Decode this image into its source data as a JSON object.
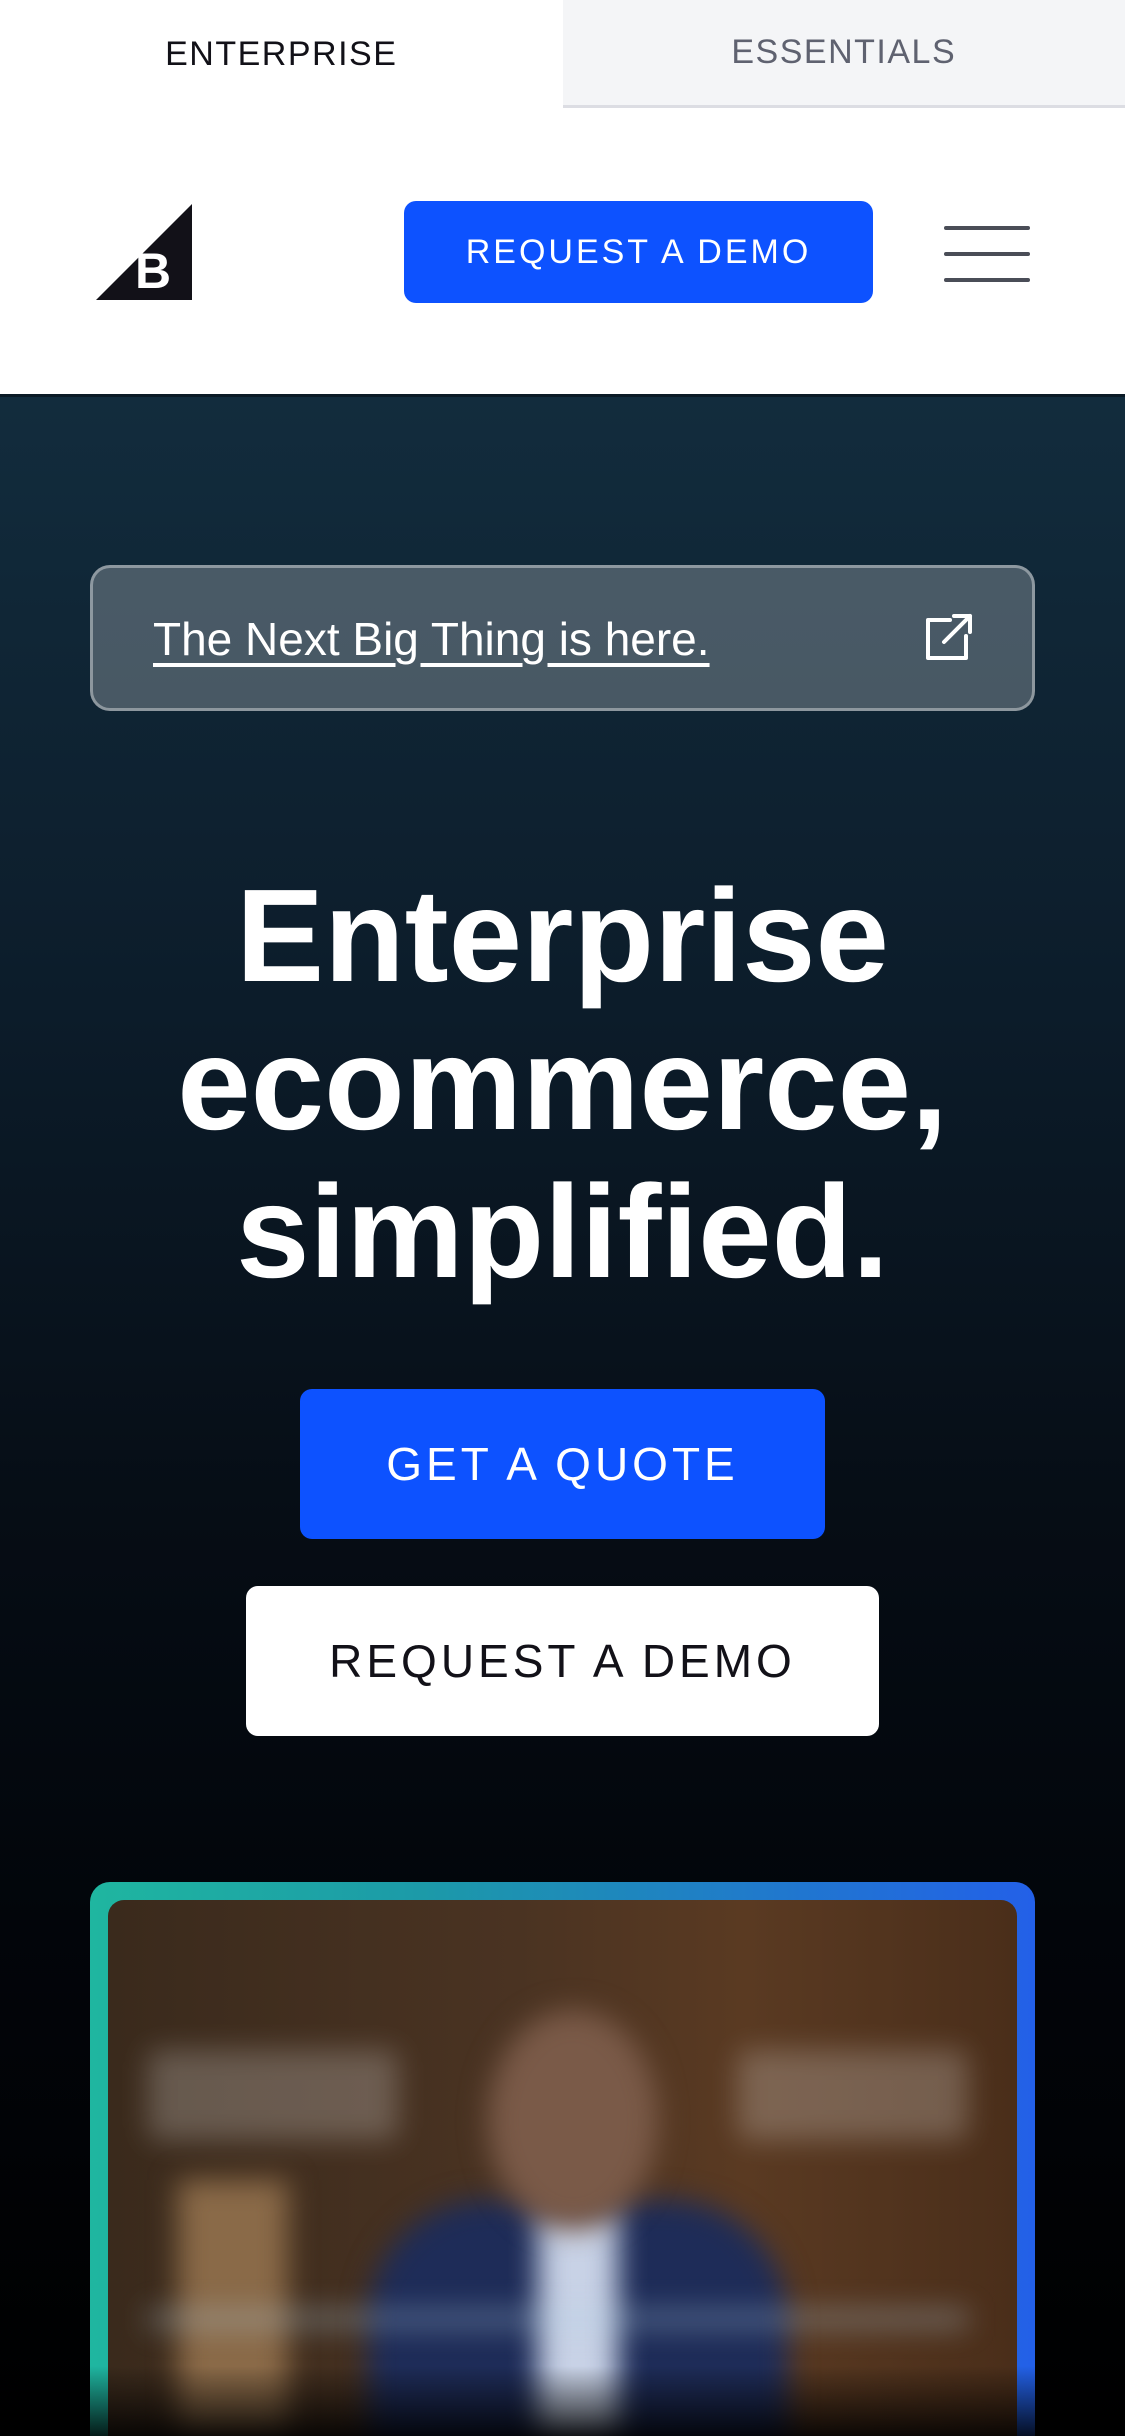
{
  "tabs": [
    {
      "label": "ENTERPRISE",
      "active": true
    },
    {
      "label": "ESSENTIALS",
      "active": false
    }
  ],
  "header": {
    "logo_icon": "bigcommerce-logo-icon",
    "cta_label": "REQUEST A DEMO",
    "menu_icon": "hamburger-menu-icon"
  },
  "hero": {
    "announcement": {
      "link_text": "The Next Big Thing is here.",
      "icon": "external-link-icon"
    },
    "headline_lines": [
      "Enterprise",
      "ecommerce,",
      "simplified."
    ],
    "primary_cta": "GET A QUOTE",
    "secondary_cta": "REQUEST A DEMO"
  },
  "video": {
    "thumbnail": "blurred-video-thumbnail"
  },
  "colors": {
    "accent": "#0d52ff",
    "hero_top": "#122c3d",
    "hero_bottom": "#000000",
    "tab_inactive_bg": "#f4f5f7",
    "text_dark": "#121118"
  }
}
